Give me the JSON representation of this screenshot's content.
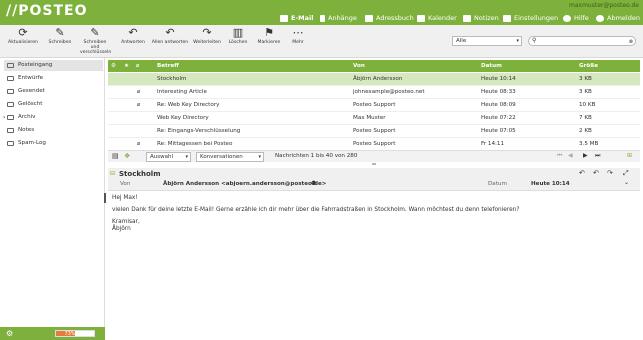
{
  "header": {
    "logo": "//POSTEO",
    "user": "maxmuster@posteo.de",
    "nav": [
      {
        "label": "E-Mail",
        "active": true
      },
      {
        "label": "Anhänge"
      },
      {
        "label": "Adressbuch"
      },
      {
        "label": "Kalender"
      },
      {
        "label": "Notizen"
      },
      {
        "label": "Einstellungen"
      },
      {
        "label": "Hilfe"
      },
      {
        "label": "Abmelden"
      }
    ]
  },
  "toolbar": {
    "buttons": [
      {
        "label": "Aktualisieren",
        "icon": "refresh-icon"
      },
      {
        "label": "Schreiben",
        "icon": "compose-icon"
      },
      {
        "label": "Schreiben und verschlüsseln",
        "icon": "compose-encrypt-icon"
      },
      {
        "label": "Antworten",
        "icon": "reply-icon"
      },
      {
        "label": "Allen antworten",
        "icon": "reply-all-icon"
      },
      {
        "label": "Weiterleiten",
        "icon": "forward-icon"
      },
      {
        "label": "Löschen",
        "icon": "trash-icon"
      },
      {
        "label": "Markieren",
        "icon": "flag-icon"
      },
      {
        "label": "Mehr",
        "icon": "more-icon"
      }
    ],
    "filter": "Alle",
    "search_placeholder": ""
  },
  "folders": [
    {
      "label": "Posteingang",
      "current": true
    },
    {
      "label": "Entwürfe"
    },
    {
      "label": "Gesendet"
    },
    {
      "label": "Gelöscht"
    },
    {
      "label": "Archiv",
      "expandable": true
    },
    {
      "label": "Notes"
    },
    {
      "label": "Spam-Log"
    }
  ],
  "quota": {
    "text": "73%",
    "fraction": 0.73
  },
  "list": {
    "headers": {
      "subject": "Betreff",
      "from": "Von",
      "date": "Datum",
      "size": "Größe"
    },
    "rows": [
      {
        "subject": "Stockholm",
        "from": "Åbjörn Andersson",
        "date": "Heute 10:14",
        "size": "3 KB",
        "selected": true,
        "attach": false
      },
      {
        "subject": "Interesting Article",
        "from": "johnexample@posteo.net",
        "date": "Heute 08:33",
        "size": "3 KB",
        "attach": true
      },
      {
        "subject": "Re: Web Key Directory",
        "from": "Posteo Support",
        "date": "Heute 08:09",
        "size": "10 KB",
        "attach": true
      },
      {
        "subject": "Web Key Directory",
        "from": "Max Muster",
        "date": "Heute 07:22",
        "size": "7 KB",
        "attach": false
      },
      {
        "subject": "Re: Eingangs-Verschlüsselung",
        "from": "Posteo Support",
        "date": "Heute 07:05",
        "size": "2 KB",
        "attach": false
      },
      {
        "subject": "Re: Mittagessen bei Posteo",
        "from": "Posteo Support",
        "date": "Fr 14:11",
        "size": "3.5 MB",
        "attach": true
      }
    ],
    "select_label": "Auswahl",
    "threads_label": "Konversationen",
    "count": "Nachrichten 1 bis 40 von 280"
  },
  "preview": {
    "subject": "Stockholm",
    "from_label": "Von",
    "from": "Åbjörn Andersson <abjoern.andersson@posteo.de>",
    "date_label": "Datum",
    "date": "Heute 10:14",
    "greeting": "Hej Max!",
    "body": "vielen Dank für deine letzte E-Mail! Gerne erzähle ich dir mehr über die Fahrradstraßen in Stockholm. Wann möchtest du denn telefonieren?",
    "closing1": "Kramisar,",
    "closing2": "Åbjörn"
  }
}
